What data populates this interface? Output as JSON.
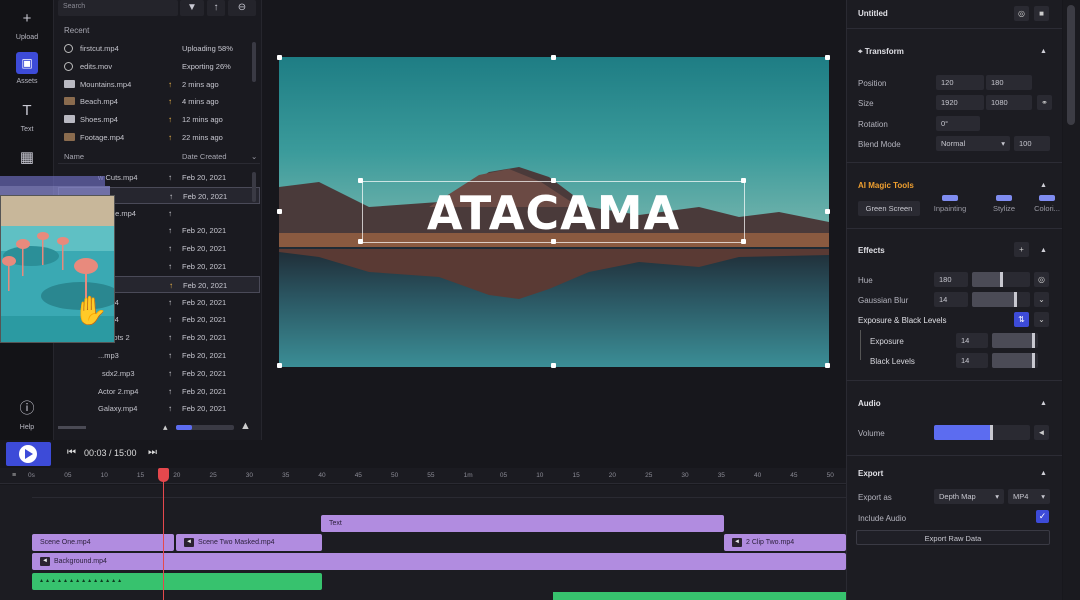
{
  "rail": {
    "upload": "Upload",
    "assets": "Assets",
    "text": "Text",
    "help": "Help"
  },
  "assets": {
    "search_placeholder": "Search",
    "recent_label": "Recent",
    "recent": [
      {
        "name": "firstcut.mp4",
        "status": "Uploading 58%"
      },
      {
        "name": "edits.mov",
        "status": "Exporting 26%"
      },
      {
        "name": "Mountains.mp4",
        "status": "2 mins ago"
      },
      {
        "name": "Beach.mp4",
        "status": "4 mins ago"
      },
      {
        "name": "Shoes.mp4",
        "status": "12 mins ago"
      },
      {
        "name": "Footage.mp4",
        "status": "22 mins ago"
      }
    ],
    "col_name": "Name",
    "col_date": "Date Created",
    "files": [
      {
        "name": "w Cuts.mp4",
        "date": "Feb 20, 2021"
      },
      {
        "name": "...",
        "date": "Feb 20, 2021"
      },
      {
        "name": "...rage.mp4",
        "date": ""
      },
      {
        "name": "",
        "date": "Feb 20, 2021"
      },
      {
        "name": "",
        "date": "Feb 20, 2021"
      },
      {
        "name": "",
        "date": "Feb 20, 2021"
      },
      {
        "name": "...ots",
        "date": "Feb 20, 2021"
      },
      {
        "name": "...mp4",
        "date": "Feb 20, 2021"
      },
      {
        "name": "...mp4",
        "date": "Feb 20, 2021"
      },
      {
        "name": "...Shots 2",
        "date": "Feb 20, 2021"
      },
      {
        "name": "...mp3",
        "date": "Feb 20, 2021"
      },
      {
        "name": "sdx2.mp3",
        "date": "Feb 20, 2021"
      },
      {
        "name": "Actor 2.mp4",
        "date": "Feb 20, 2021"
      },
      {
        "name": "Galaxy.mp4",
        "date": "Feb 20, 2021"
      }
    ]
  },
  "preview": {
    "title": "ATACAMA"
  },
  "transport": {
    "time": "00:03 / 15:00"
  },
  "ruler": [
    "0s",
    "05",
    "10",
    "15",
    "20",
    "25",
    "30",
    "35",
    "40",
    "45",
    "50",
    "55",
    "1m",
    "05",
    "10",
    "15",
    "20",
    "25",
    "30",
    "35",
    "40",
    "45",
    "50"
  ],
  "tracks": {
    "text_clip": "Text",
    "scene_one": "Scene One.mp4",
    "scene_two": "Scene Two Masked.mp4",
    "clip_two": "2 Clip Two.mp4",
    "background": "Background.mp4",
    "audio_wave": "▴▴▴▴▴▴▴▴▴▴▴▴▴▴"
  },
  "right": {
    "doc_title": "Untitled",
    "transform": "Transform",
    "position": "Position",
    "pos_x": "120",
    "pos_y": "180",
    "size": "Size",
    "size_w": "1920",
    "size_h": "1080",
    "rotation": "Rotation",
    "rot": "0°",
    "blend": "Blend Mode",
    "blend_val": "Normal",
    "opacity": "100",
    "ai_tools": "AI Magic Tools",
    "ai_tabs": [
      "Green Screen",
      "Inpainting",
      "Stylize",
      "Colori..."
    ],
    "effects": "Effects",
    "hue": "Hue",
    "hue_val": "180",
    "blur": "Gaussian Blur",
    "blur_val": "14",
    "exposure_black": "Exposure & Black Levels",
    "exposure": "Exposure",
    "exposure_val": "14",
    "black": "Black Levels",
    "black_val": "14",
    "audio": "Audio",
    "volume": "Volume",
    "volume_level": 0.6,
    "export": "Export",
    "export_as": "Export as",
    "export_type": "Depth Map",
    "export_fmt": "MP4",
    "include_audio": "Include Audio",
    "export_btn": "Export Raw Data"
  },
  "colors": {
    "accent": "#3d4bd8",
    "clip_purple": "#b18ce0",
    "clip_green": "#37c26e",
    "playhead": "#e5484d",
    "ai_orange": "#f0a030"
  }
}
